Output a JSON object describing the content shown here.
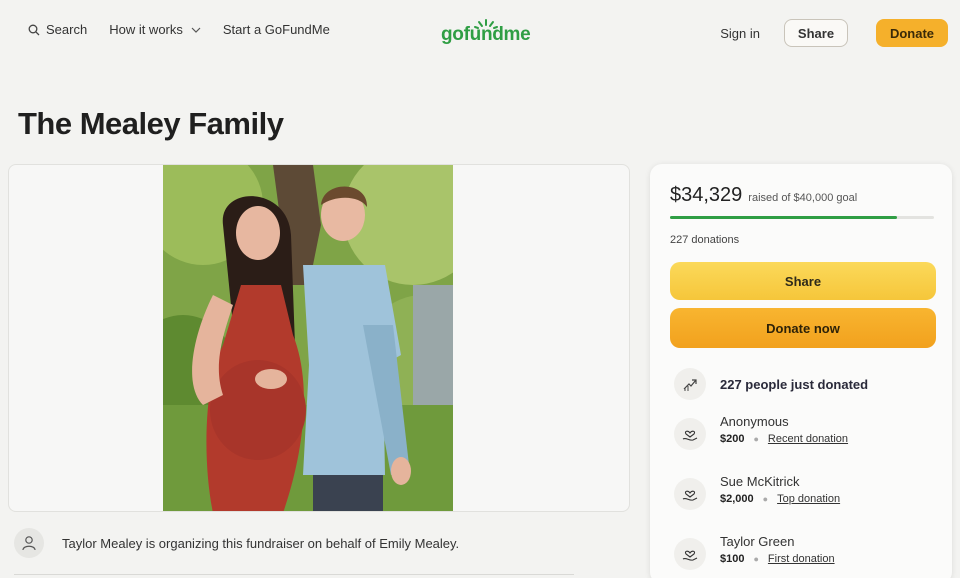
{
  "nav": {
    "search": "Search",
    "how_it_works": "How it works",
    "start": "Start a GoFundMe",
    "logo": "gofundme",
    "sign_in": "Sign in",
    "share": "Share",
    "donate": "Donate"
  },
  "campaign": {
    "title": "The Mealey Family",
    "organizer_text": "Taylor Mealey is organizing this fundraiser on behalf of Emily Mealey."
  },
  "donation_box": {
    "raised": "$34,329",
    "goal_text": "raised of $40,000 goal",
    "progress_fraction": 0.858,
    "donation_count": "227 donations",
    "share_label": "Share",
    "donate_label": "Donate now",
    "just_donated": "227 people just donated",
    "donors": [
      {
        "name": "Anonymous",
        "amount": "$200",
        "tag": "Recent donation"
      },
      {
        "name": "Sue McKitrick",
        "amount": "$2,000",
        "tag": "Top donation"
      },
      {
        "name": "Taylor Green",
        "amount": "$100",
        "tag": "First donation"
      }
    ]
  },
  "colors": {
    "brand_green": "#2f9e44",
    "donate_orange": "#f5b02b",
    "share_yellow": "#f6c63a"
  }
}
